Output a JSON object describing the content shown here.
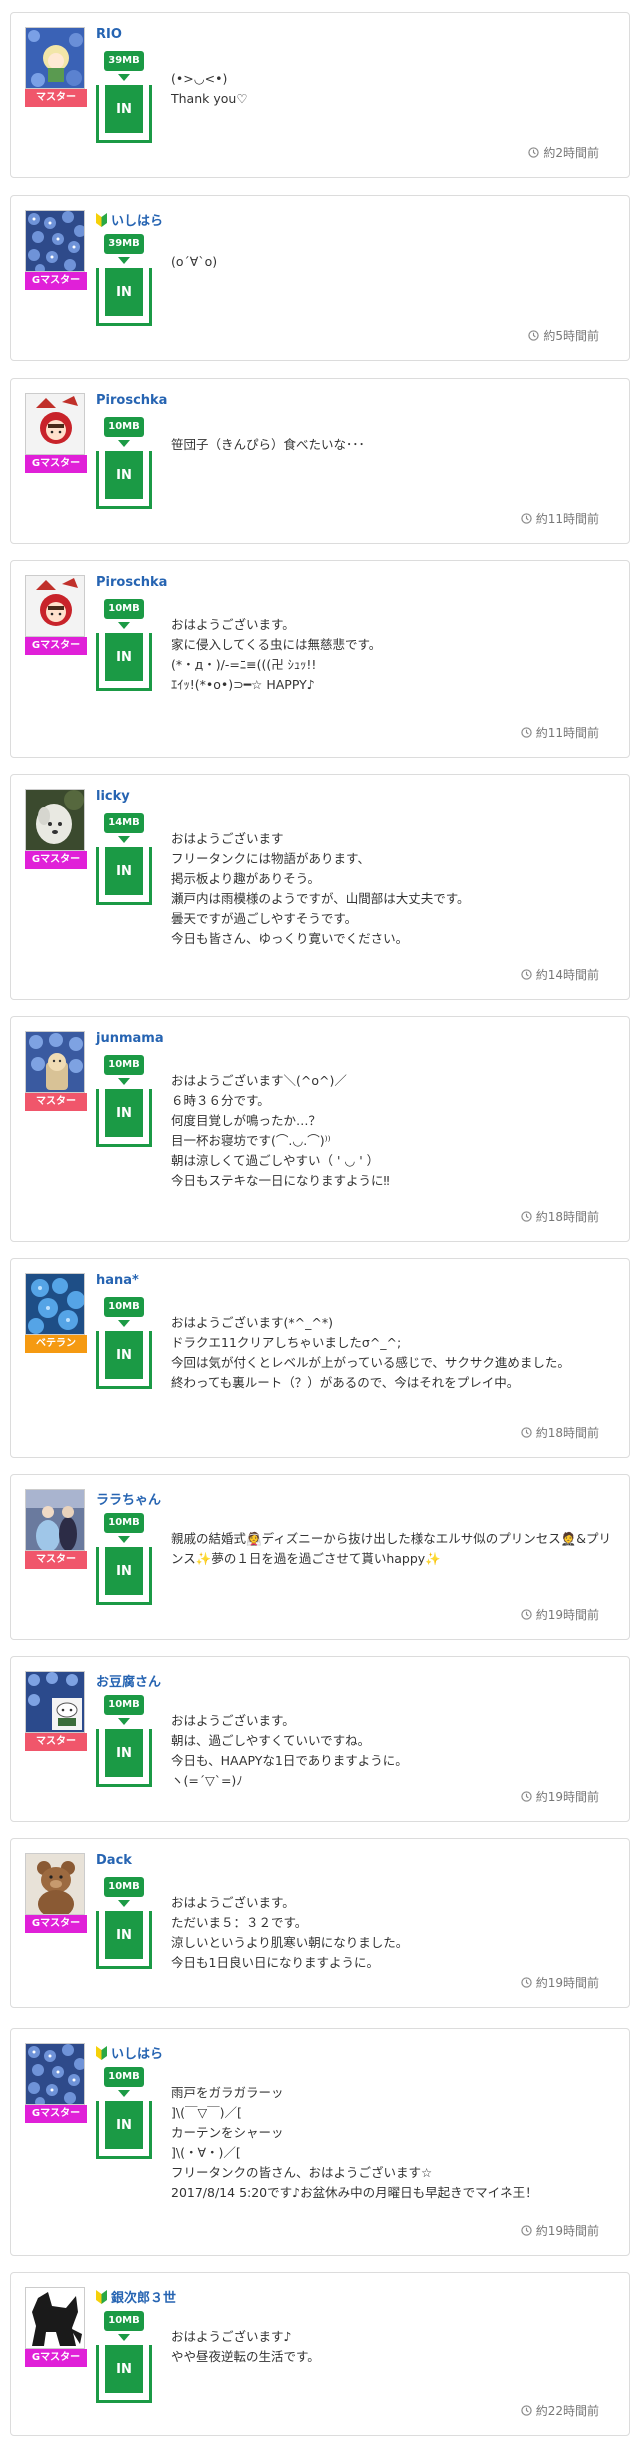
{
  "posts": [
    {
      "name": "RIO",
      "beginner": false,
      "rank": "マスター",
      "rank_color": "red",
      "size": "39MB",
      "in": "IN",
      "avatar": "rio",
      "time": "約2時間前",
      "lines": [
        "(•>◡<•)",
        "Thank you♡"
      ]
    },
    {
      "name": "いしはら",
      "beginner": true,
      "rank": "Gマスター",
      "rank_color": "magenta",
      "size": "39MB",
      "in": "IN",
      "avatar": "flowers",
      "time": "約5時間前",
      "lines": [
        "(o´∀`o)"
      ]
    },
    {
      "name": "Piroschka",
      "beginner": false,
      "rank": "Gマスター",
      "rank_color": "magenta",
      "size": "10MB",
      "in": "IN",
      "avatar": "hood",
      "time": "約11時間前",
      "lines": [
        "笹団子（きんぴら）食べたいな･･･"
      ]
    },
    {
      "name": "Piroschka",
      "beginner": false,
      "rank": "Gマスター",
      "rank_color": "magenta",
      "size": "10MB",
      "in": "IN",
      "avatar": "hood",
      "time": "約11時間前",
      "lines": [
        "おはようございます。",
        "家に侵入してくる虫には無慈悲です。",
        "(*・д・)/-=ﾆ≡(((卍 ｼｭｯ!!",
        "ｴｲｯ!(*•o•)⊃━☆ HAPPY♪"
      ]
    },
    {
      "name": "licky",
      "beginner": false,
      "rank": "Gマスター",
      "rank_color": "magenta",
      "size": "14MB",
      "in": "IN",
      "avatar": "dog",
      "time": "約14時間前",
      "lines": [
        "おはようございます",
        "フリータンクには物語があります、",
        "掲示板より趣がありそう。",
        "瀬戸内は雨模様のようですが、山間部は大丈夫です。",
        "曇天ですが過ごしやすそうです。",
        "今日も皆さん、ゆっくり寛いでください。"
      ]
    },
    {
      "name": "junmama",
      "beginner": false,
      "rank": "マスター",
      "rank_color": "red",
      "size": "10MB",
      "in": "IN",
      "avatar": "junmama",
      "time": "約18時間前",
      "lines": [
        "おはようございます＼(^o^)／",
        "６時３６分です。",
        "何度目覚しが鳴ったか…？",
        "目一杯お寝坊です(⌒.◡.⌒)⁾⁾",
        "朝は涼しくて過ごしやすい（ ' ◡ ' ）",
        "今日もステキな一日になりますように‼"
      ]
    },
    {
      "name": "hana*",
      "beginner": false,
      "rank": "ベテラン",
      "rank_color": "orange",
      "size": "10MB",
      "in": "IN",
      "avatar": "hydrangea",
      "time": "約18時間前",
      "lines": [
        "おはようございます(*^_^*)",
        "ドラクエ11クリアしちゃいましたσ^_^;",
        "今回は気が付くとレベルが上がっている感じで、サクサク進めました。",
        "終わっても裏ルート（？）があるので、今はそれをプレイ中。"
      ]
    },
    {
      "name": "ララちゃん",
      "beginner": false,
      "rank": "マスター",
      "rank_color": "red",
      "size": "10MB",
      "in": "IN",
      "avatar": "princess",
      "time": "約19時間前",
      "lines": [
        "親戚の結婚式👰ディズニーから抜け出した様なエルサ似のプリンセス🤵&プリンス✨夢の１日を過を過ごさせて貰いhappy✨"
      ]
    },
    {
      "name": "お豆腐さん",
      "beginner": false,
      "rank": "マスター",
      "rank_color": "red",
      "size": "10MB",
      "in": "IN",
      "avatar": "tofu",
      "time": "約19時間前",
      "lines": [
        "おはようございます。",
        "朝は、過ごしやすくていいですね。",
        "今日も、HAAPYな1日でありますように。",
        "ヽ(=´▽`=)ﾉ"
      ]
    },
    {
      "name": "Dack",
      "beginner": false,
      "rank": "Gマスター",
      "rank_color": "magenta",
      "size": "10MB",
      "in": "IN",
      "avatar": "bear",
      "time": "約19時間前",
      "lines": [
        "おはようございます。",
        "ただいま５：３２です。",
        "涼しいというより肌寒い朝になりました。",
        "今日も1日良い日になりますように。"
      ]
    },
    {
      "name": "いしはら",
      "beginner": true,
      "rank": "Gマスター",
      "rank_color": "magenta",
      "size": "10MB",
      "in": "IN",
      "avatar": "flowers",
      "time": "約19時間前",
      "lines": [
        "雨戸をガラガラーッ",
        "]\\(￣▽￣)／[",
        "カーテンをシャーッ",
        "]\\(・∀・)／[",
        "フリータンクの皆さん、おはようございます☆",
        "2017/8/14 5:20です♪お盆休み中の月曜日も早起きでマイネ王！"
      ]
    },
    {
      "name": "銀次郎３世",
      "beginner": true,
      "rank": "Gマスター",
      "rank_color": "magenta",
      "size": "10MB",
      "in": "IN",
      "avatar": "wolf",
      "time": "約22時間前",
      "lines": [
        "おはようございます♪",
        "やや昼夜逆転の生活です。"
      ]
    }
  ]
}
